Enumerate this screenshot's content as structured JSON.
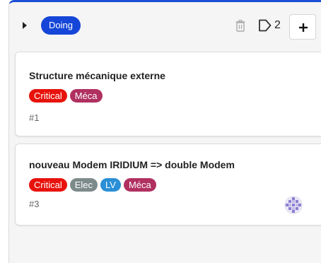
{
  "column": {
    "status_label": "Doing",
    "status_color": "#1546d8",
    "accent_color": "#1d4fd6",
    "cards_count": "2",
    "icons": [
      "caret-right-icon",
      "trash-icon",
      "cards-count-icon",
      "plus-icon"
    ]
  },
  "cards": [
    {
      "title": "Structure mécanique externe",
      "ref": "#1",
      "labels": [
        {
          "text": "Critical",
          "color": "#e8120c"
        },
        {
          "text": "Méca",
          "color": "#b03060"
        }
      ]
    },
    {
      "title": "nouveau Modem IRIDIUM => double Modem",
      "ref": "#3",
      "labels": [
        {
          "text": "Critical",
          "color": "#e8120c"
        },
        {
          "text": "Elec",
          "color": "#7d8a8a"
        },
        {
          "text": "LV",
          "color": "#2a8fd6"
        },
        {
          "text": "Méca",
          "color": "#b03060"
        }
      ],
      "assignee_avatar": "avatar-icon"
    }
  ]
}
